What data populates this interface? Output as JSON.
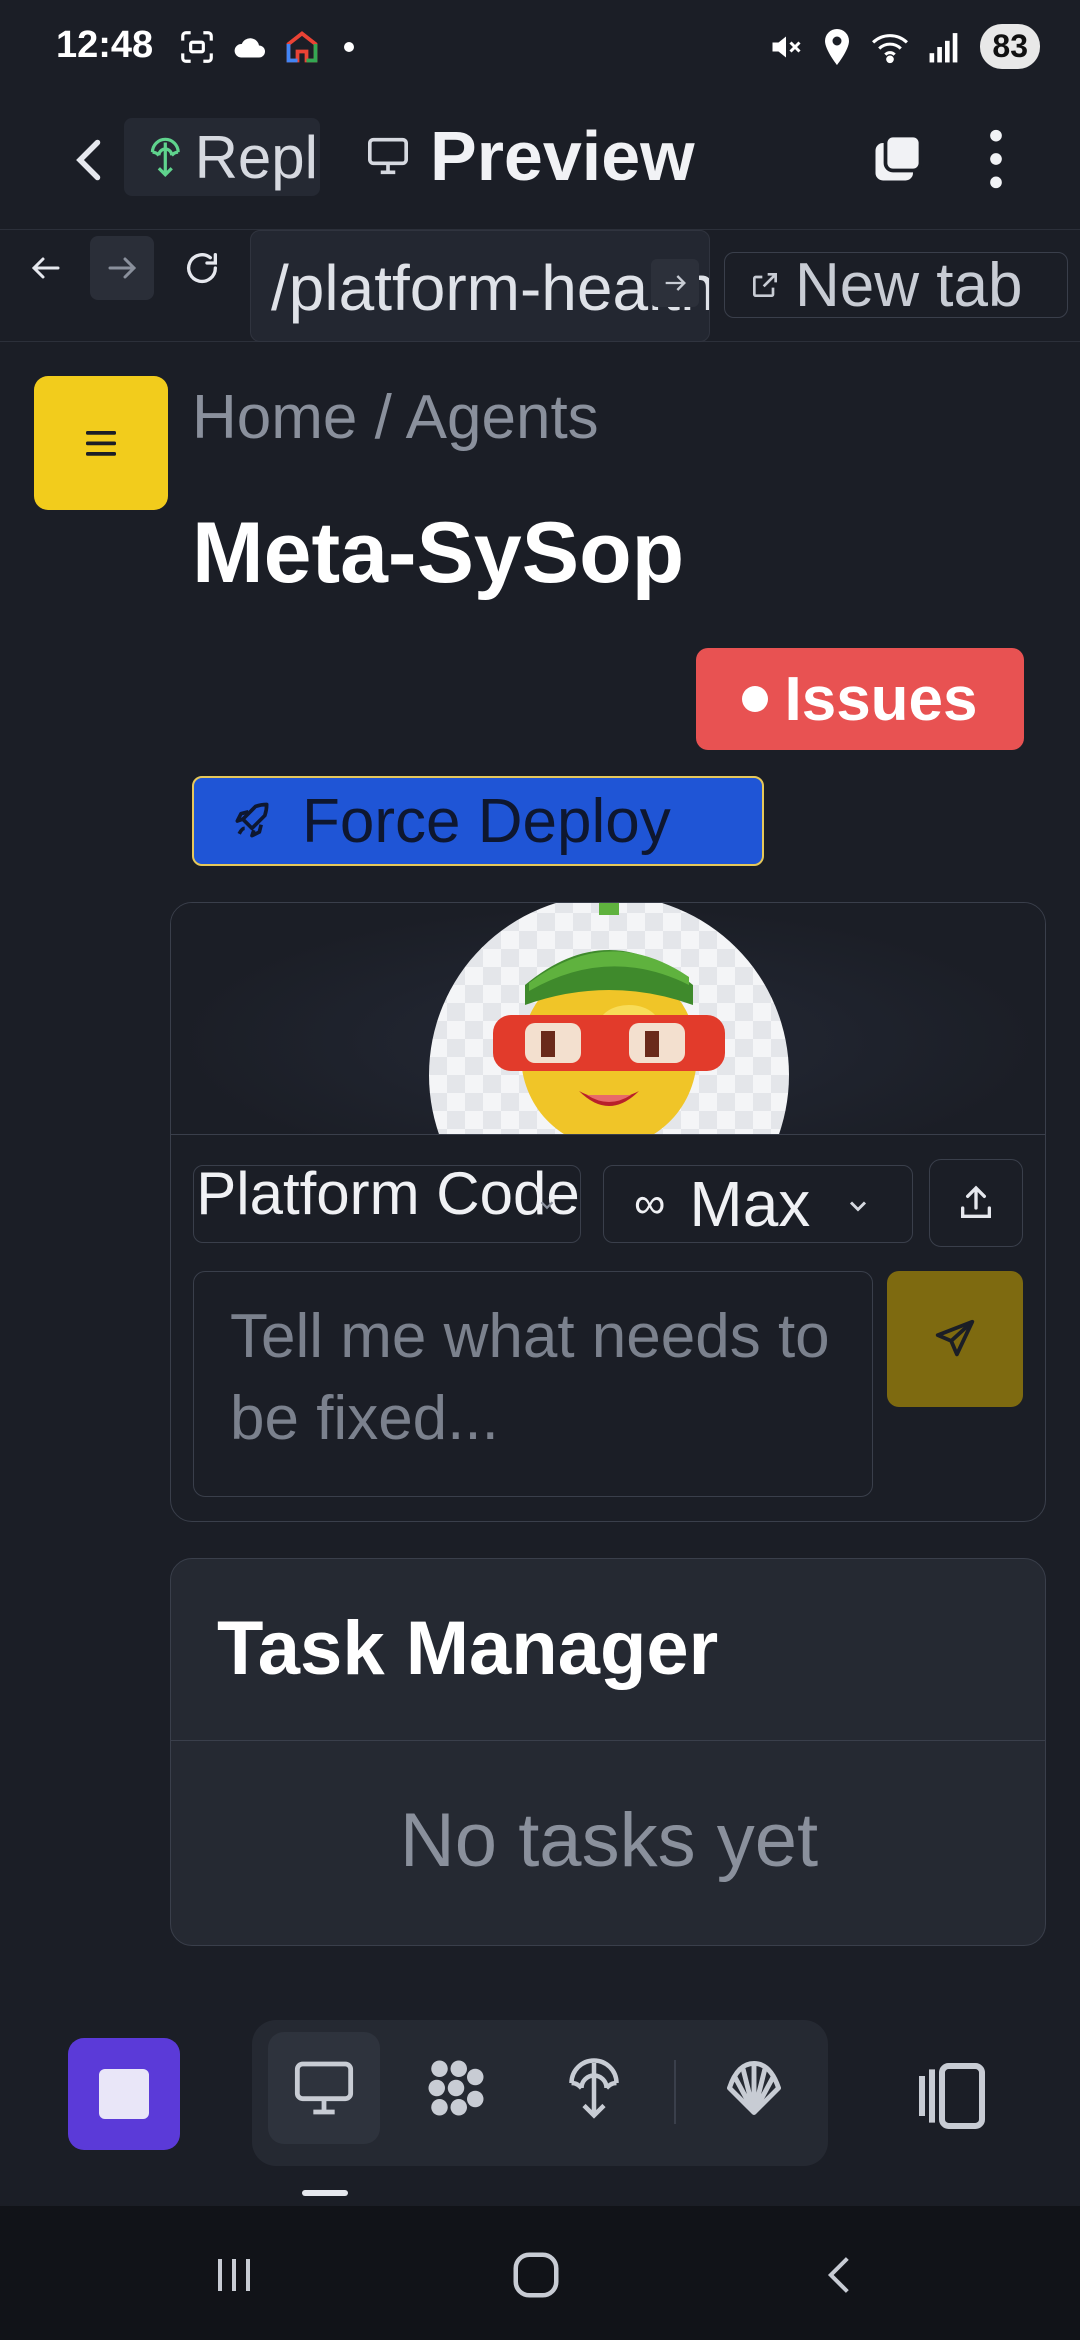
{
  "status_bar": {
    "time": "12:48",
    "battery": "83",
    "left_icons": [
      "screenshot-icon",
      "cloud-icon",
      "google-home-icon",
      "dot-icon"
    ],
    "right_icons": [
      "mute-icon",
      "location-icon",
      "wifi-icon",
      "signal-icon"
    ]
  },
  "app_header": {
    "repl_chip_label": "Repl",
    "preview_label": "Preview"
  },
  "url_bar": {
    "path": "/platform-health",
    "new_tab_label": "New tab"
  },
  "page": {
    "breadcrumb": "Home / Agents",
    "title": "Meta-SySop",
    "issues_label": "Issues",
    "force_deploy_label": "Force Deploy"
  },
  "chat": {
    "platform_select": "Platform Code",
    "mode_select": "Max",
    "mode_symbol": "∞",
    "message_placeholder": "Tell me what needs to be fixed..."
  },
  "task_manager": {
    "title": "Task Manager",
    "empty_text": "No tasks yet"
  },
  "colors": {
    "background": "#1b1e26",
    "menu_button": "#f2cc1c",
    "issues_badge": "#e85252",
    "force_deploy": "#1f55d6",
    "send_button": "#7e6a10",
    "stop_button": "#5b3ad8"
  },
  "bottom_toolbar": {
    "tools": [
      "desktop-icon",
      "grid-apps-icon",
      "deploy-icon",
      "shell-icon"
    ],
    "active_tool": "desktop-icon"
  }
}
